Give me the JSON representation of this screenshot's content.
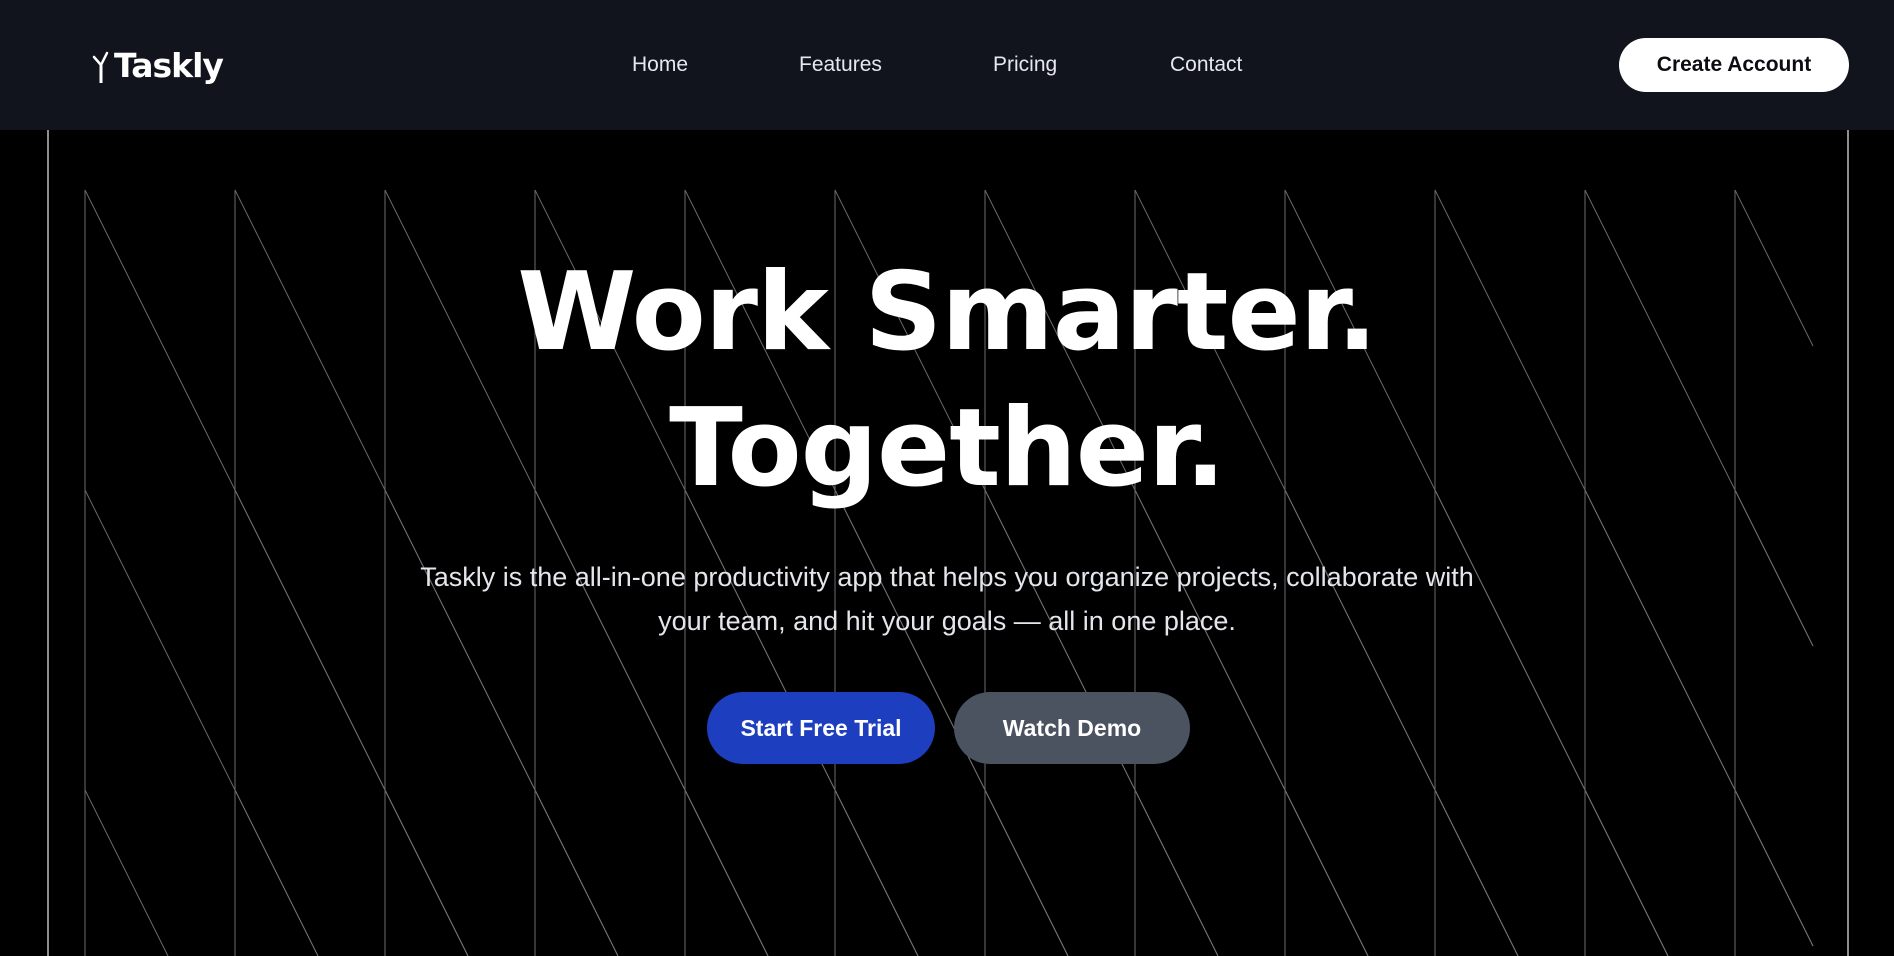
{
  "nav": {
    "logo_text": "Taskly",
    "links": [
      "Home",
      "Features",
      "Pricing",
      "Contact"
    ],
    "cta_label": "Create Account"
  },
  "hero": {
    "title_line1": "Work Smarter.",
    "title_line2": "Together.",
    "subtitle": "Taskly is the all-in-one productivity app that helps you organize projects, collaborate with your team, and hit your goals — all in one place.",
    "primary_cta": "Start Free Trial",
    "secondary_cta": "Watch Demo"
  },
  "colors": {
    "nav_background": "#11141c",
    "hero_background": "#000000",
    "primary_button": "#1d3ebf",
    "secondary_button": "#4b5260",
    "pattern_line": "#6b6b6b"
  }
}
